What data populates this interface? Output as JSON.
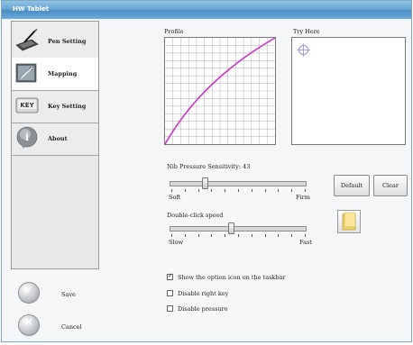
{
  "window": {
    "title": "HW Tablet"
  },
  "sidebar": {
    "items": [
      {
        "label": "Pen Setting",
        "icon": "pen-tablet-icon"
      },
      {
        "label": "Mapping",
        "icon": "mapping-icon"
      },
      {
        "label": "Key Setting",
        "icon": "keyboard-key-icon",
        "icon_text": "KEY"
      },
      {
        "label": "About",
        "icon": "info-icon",
        "icon_text": "i"
      }
    ],
    "active_index": 1
  },
  "actions": {
    "save_label": "Save",
    "cancel_label": "Cancel",
    "save_glyph": "✓",
    "cancel_glyph": "✕"
  },
  "profile": {
    "label": "Profile",
    "curve_color": "#cc33cc",
    "grid_color": "#bdbdbd"
  },
  "try_area": {
    "label": "Try Here"
  },
  "pressure": {
    "title": "Nib Pressure Sensitivity:",
    "value": "43",
    "min_label": "Soft",
    "max_label": "Firm",
    "level_fraction": 0.25
  },
  "double_click": {
    "title": "Double-click speed",
    "min_label": "Slow",
    "max_label": "Fast",
    "level_fraction": 0.45
  },
  "buttons": {
    "default_label": "Default",
    "clear_label": "Clear",
    "folder_icon": "folder-icon"
  },
  "options": [
    {
      "label": "Show the option icon on the taskbar",
      "checked": true
    },
    {
      "label": "Disable right key",
      "checked": false
    },
    {
      "label": "Disable pressure",
      "checked": false
    }
  ],
  "check_glyph": "✓"
}
